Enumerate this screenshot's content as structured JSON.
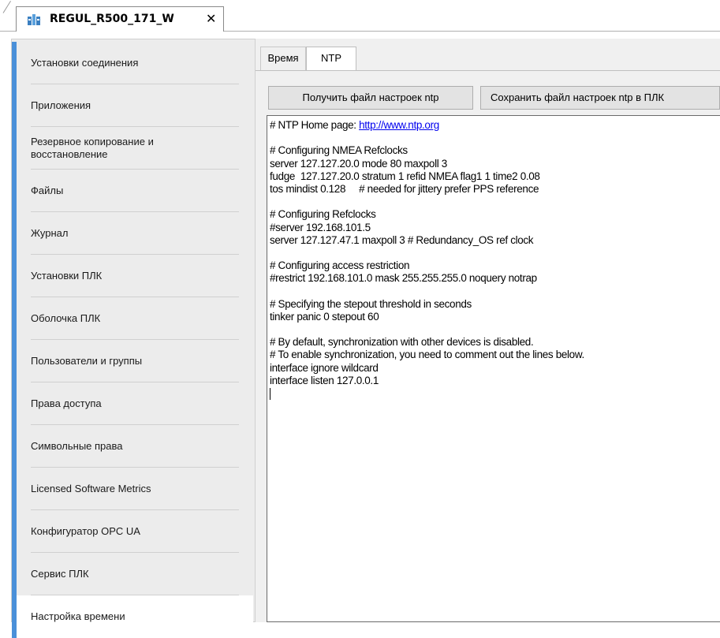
{
  "document_tab": {
    "title": "REGUL_R500_171_W",
    "close_glyph": "✕",
    "icon": "device-icon"
  },
  "sidebar": {
    "accent_color": "#4a90d9",
    "items": [
      {
        "label": "Установки соединения"
      },
      {
        "label": "Приложения"
      },
      {
        "label": "Резервное копирование и\nвосстановление"
      },
      {
        "label": "Файлы"
      },
      {
        "label": "Журнал"
      },
      {
        "label": "Установки ПЛК"
      },
      {
        "label": "Оболочка ПЛК"
      },
      {
        "label": "Пользователи и группы"
      },
      {
        "label": "Права доступа"
      },
      {
        "label": "Символьные права"
      },
      {
        "label": "Licensed Software Metrics"
      },
      {
        "label": "Конфигуратор OPC UA"
      },
      {
        "label": "Сервис ПЛК"
      },
      {
        "label": "Настройка времени"
      }
    ]
  },
  "tabs": {
    "time": "Время",
    "ntp": "NTP"
  },
  "buttons": {
    "get_ntp": "Получить файл настроек ntp",
    "save_ntp": "Сохранить файл настроек ntp в ПЛК"
  },
  "editor": {
    "line_0_prefix": "# NTP Home page: ",
    "line_0_link": "http://www.ntp.org",
    "lines": [
      "",
      "# Configuring NMEA Refclocks",
      "server 127.127.20.0 mode 80 maxpoll 3",
      "fudge  127.127.20.0 stratum 1 refid NMEA flag1 1 time2 0.08",
      "tos mindist 0.128     # needed for jittery prefer PPS reference",
      "",
      "# Configuring Refclocks",
      "#server 192.168.101.5",
      "server 127.127.47.1 maxpoll 3 # Redundancy_OS ref clock",
      "",
      "# Configuring access restriction",
      "#restrict 192.168.101.0 mask 255.255.255.0 noquery notrap",
      "",
      "# Specifying the stepout threshold in seconds",
      "tinker panic 0 stepout 60",
      "",
      "# By default, synchronization with other devices is disabled.",
      "# To enable synchronization, you need to comment out the lines below.",
      "interface ignore wildcard",
      "interface listen 127.0.0.1"
    ]
  }
}
